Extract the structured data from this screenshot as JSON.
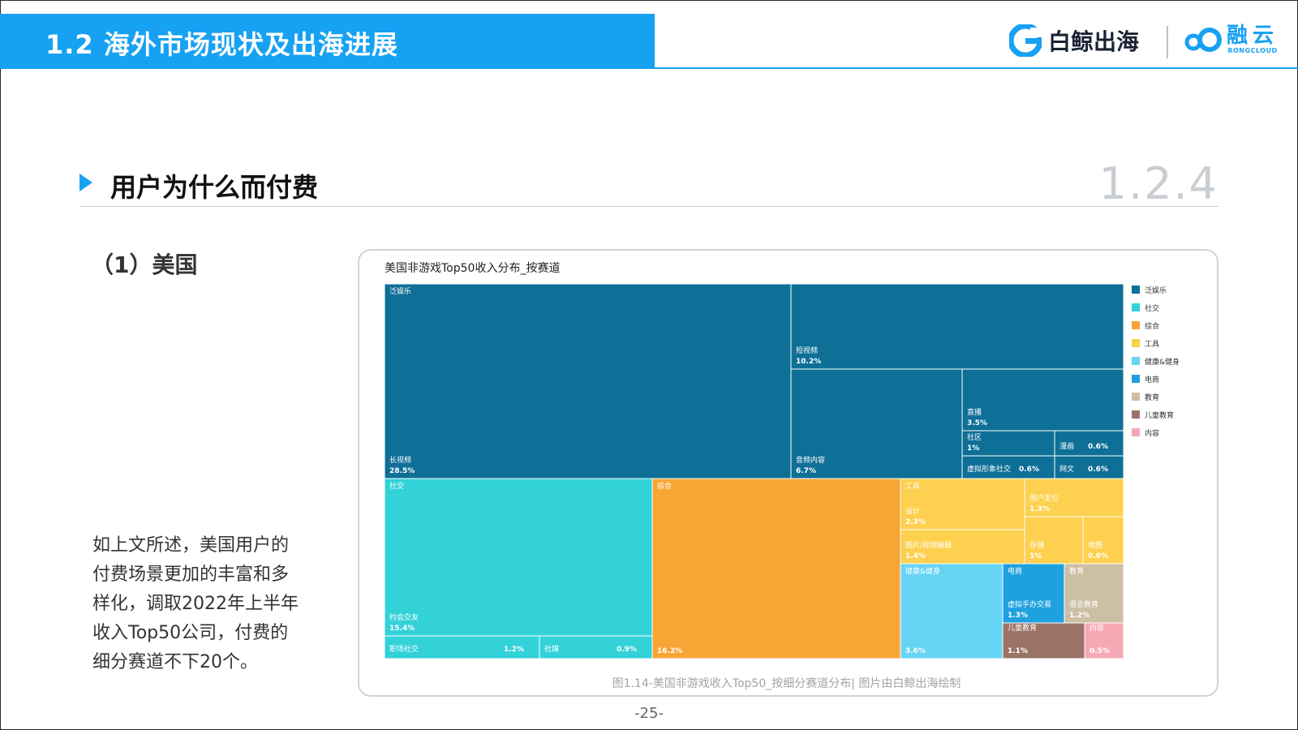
{
  "header": {
    "title": "1.2 海外市场现状及出海进展",
    "brand1": "白鲸出海",
    "brand2_cn": "融云",
    "brand2_en": "RONGCLOUD"
  },
  "section": {
    "title": "用户为什么而付费",
    "number": "1.2.4"
  },
  "subtitle": "（1）美国",
  "body_text": "如上文所述，美国用户的付费场景更加的丰富和多样化，调取2022年上半年收入Top50公司，付费的细分赛道不下20个。",
  "caption": "图1.14-美国非游戏收入Top50_按细分赛道分布| 图片由白鲸出海绘制",
  "page_number": "-25-",
  "colors": {
    "accent": "#17a1f2",
    "泛娱乐": "#0e6f97",
    "社交": "#33d2d8",
    "综合": "#f7a636",
    "工具": "#fdd050",
    "健康&健身": "#66d4f5",
    "电商": "#1fa1e0",
    "教育": "#cdbfa4",
    "儿童教育": "#9b7468",
    "内容": "#f6a9b5"
  },
  "chart_data": {
    "type": "treemap",
    "title": "美国非游戏Top50收入分布_按赛道",
    "legend_placement": "right",
    "legend": [
      "泛娱乐",
      "社交",
      "综合",
      "工具",
      "健康&健身",
      "电商",
      "教育",
      "儿童教育",
      "内容"
    ],
    "categories": [
      {
        "name": "泛娱乐",
        "children": [
          {
            "name": "长视频",
            "value": "28.5%"
          },
          {
            "name": "短视频",
            "value": "10.2%"
          },
          {
            "name": "音频内容",
            "value": "6.7%"
          },
          {
            "name": "直播",
            "value": "3.5%"
          },
          {
            "name": "社区",
            "value": "1%"
          },
          {
            "name": "漫画",
            "value": "0.6%"
          },
          {
            "name": "虚拟形象社交",
            "value": "0.6%"
          },
          {
            "name": "网文",
            "value": "0.6%"
          }
        ]
      },
      {
        "name": "社交",
        "children": [
          {
            "name": "约会交友",
            "value": "15.4%"
          },
          {
            "name": "职场社交",
            "value": "1.2%"
          },
          {
            "name": "社媒",
            "value": "0.9%"
          }
        ]
      },
      {
        "name": "综合",
        "children": [
          {
            "name": "",
            "value": "16.2%"
          }
        ]
      },
      {
        "name": "工具",
        "children": [
          {
            "name": "设计",
            "value": "2.3%"
          },
          {
            "name": "用户定位",
            "value": "1.3%"
          },
          {
            "name": "图片/视频编辑",
            "value": "1.4%"
          },
          {
            "name": "存储",
            "value": "1%"
          },
          {
            "name": "地图",
            "value": "0.6%"
          }
        ]
      },
      {
        "name": "健康&健身",
        "children": [
          {
            "name": "",
            "value": "3.6%"
          }
        ]
      },
      {
        "name": "电商",
        "children": [
          {
            "name": "虚拟手办交易",
            "value": "1.3%"
          }
        ]
      },
      {
        "name": "教育",
        "children": [
          {
            "name": "语言教育",
            "value": "1.2%"
          }
        ]
      },
      {
        "name": "儿童教育",
        "children": [
          {
            "name": "",
            "value": "1.1%"
          }
        ]
      },
      {
        "name": "内容",
        "children": [
          {
            "name": "",
            "value": "0.5%"
          }
        ]
      }
    ]
  }
}
